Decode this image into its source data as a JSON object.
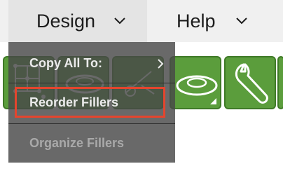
{
  "menubar": {
    "menus": [
      {
        "label": "Design",
        "icon": "chevron-down-icon"
      },
      {
        "label": "Help",
        "icon": "chevron-down-icon"
      }
    ]
  },
  "dropdown": {
    "items": [
      {
        "label": "Copy All To:",
        "icon": "chevron-right-icon",
        "enabled": true,
        "has_submenu": true
      },
      {
        "label": "Reorder Fillers",
        "enabled": true,
        "highlighted": true
      },
      {
        "label": "Organize Fillers",
        "enabled": false
      }
    ]
  },
  "toolbar": {
    "tools": [
      {
        "icon": "node-grid-icon"
      },
      {
        "icon": "filler-icon"
      },
      {
        "icon": "cutting-tool-icon"
      },
      {
        "icon": "filler-icon",
        "has_menu": true
      },
      {
        "icon": "wrench-icon"
      }
    ]
  },
  "colors": {
    "toolbar_green": "#5b9d3c",
    "menu_overlay": "#484848",
    "highlight_red": "#e4452e"
  }
}
